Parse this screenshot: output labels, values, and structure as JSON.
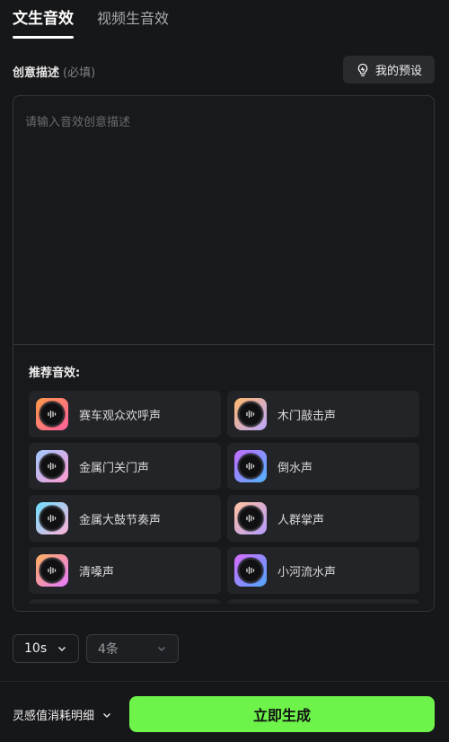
{
  "tabs": [
    {
      "label": "文生音效",
      "active": true
    },
    {
      "label": "视频生音效",
      "active": false
    }
  ],
  "description": {
    "label": "创意描述",
    "required_hint": "(必填)",
    "placeholder": "请输入音效创意描述",
    "value": ""
  },
  "preset_button": {
    "label": "我的预设",
    "icon": "lightbulb-icon"
  },
  "recommended": {
    "title": "推荐音效:",
    "items": [
      {
        "label": "赛车观众欢呼声",
        "gradient": [
          "#ff9a4a",
          "#ff5f9e"
        ]
      },
      {
        "label": "木门敲击声",
        "gradient": [
          "#ffb86b",
          "#b9a7ff"
        ]
      },
      {
        "label": "金属门关门声",
        "gradient": [
          "#9ec9ff",
          "#ff9ad0"
        ]
      },
      {
        "label": "倒水声",
        "gradient": [
          "#c56bff",
          "#4fb4ff"
        ]
      },
      {
        "label": "金属大鼓节奏声",
        "gradient": [
          "#6ee0ff",
          "#ffb2d8"
        ]
      },
      {
        "label": "人群掌声",
        "gradient": [
          "#ffc3a0",
          "#b49bff"
        ]
      },
      {
        "label": "清嗓声",
        "gradient": [
          "#ffaf5e",
          "#e57bff"
        ]
      },
      {
        "label": "小河流水声",
        "gradient": [
          "#d86bff",
          "#4fa6ff"
        ]
      },
      {
        "label": "",
        "gradient": [
          "#6fe3ff",
          "#7df5d0"
        ]
      },
      {
        "label": "",
        "gradient": [
          "#ff9a6b",
          "#ff6b9e"
        ]
      }
    ]
  },
  "duration_select": {
    "value": "10s"
  },
  "count_select": {
    "value": "4条"
  },
  "cost_detail": {
    "label": "灵感值消耗明细"
  },
  "generate_button": {
    "label": "立即生成"
  },
  "colors": {
    "accent": "#6df34a",
    "background": "#161719",
    "card": "#232428"
  }
}
